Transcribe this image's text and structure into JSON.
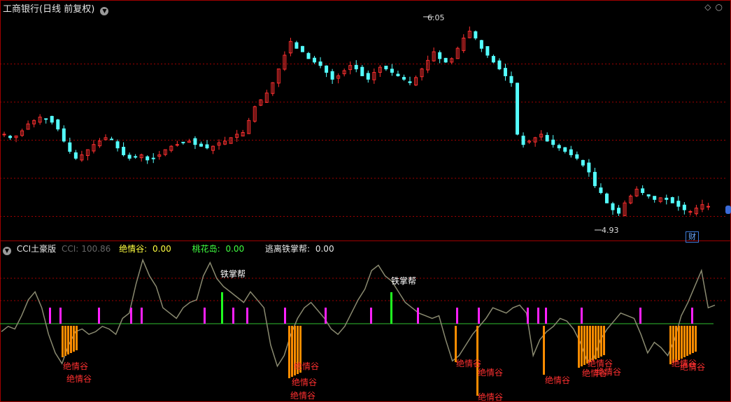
{
  "header": {
    "title": "工商银行(日线 前复权)",
    "right_icons": [
      "diamond-icon",
      "circle-icon"
    ]
  },
  "price_chart": {
    "high_label": "6.05",
    "low_label": "4.93",
    "badge": "财",
    "colors": {
      "up": "#ff3030",
      "down": "#54ffff",
      "grid": "#a00000"
    }
  },
  "indicator": {
    "name": "CCI土豪版",
    "cci_label": "CCI:",
    "cci_value": "100.86",
    "juequgu_label": "绝情谷:",
    "juequgu_value": "0.00",
    "taohuadao_label": "桃花岛:",
    "taohuadao_value": "0.00",
    "taoli_label": "逃离铁掌帮:",
    "taoli_value": "0.00",
    "signal_text_green": "铁掌帮",
    "signal_text_red": "绝情谷",
    "colors": {
      "cci": "#8a8a70",
      "zero": "#30c030",
      "magenta": "#ff20ff",
      "green": "#20ff20",
      "orange": "#ff8c00",
      "red_text": "#ff3030"
    }
  },
  "chart_data": [
    {
      "type": "candlestick",
      "title": "工商银行(日线 前复权)",
      "annotations": [
        {
          "label": "6.05",
          "kind": "high"
        },
        {
          "label": "4.93",
          "kind": "low"
        }
      ],
      "close": [
        5.42,
        5.4,
        5.41,
        5.44,
        5.48,
        5.5,
        5.52,
        5.51,
        5.49,
        5.45,
        5.38,
        5.32,
        5.28,
        5.3,
        5.33,
        5.36,
        5.38,
        5.4,
        5.39,
        5.34,
        5.3,
        5.28,
        5.29,
        5.3,
        5.27,
        5.28,
        5.3,
        5.33,
        5.35,
        5.36,
        5.37,
        5.38,
        5.36,
        5.35,
        5.34,
        5.35,
        5.37,
        5.38,
        5.4,
        5.42,
        5.43,
        5.5,
        5.58,
        5.62,
        5.66,
        5.72,
        5.8,
        5.88,
        5.96,
        5.92,
        5.9,
        5.86,
        5.84,
        5.82,
        5.78,
        5.74,
        5.76,
        5.79,
        5.82,
        5.8,
        5.76,
        5.74,
        5.78,
        5.81,
        5.8,
        5.78,
        5.76,
        5.74,
        5.72,
        5.75,
        5.8,
        5.85,
        5.9,
        5.86,
        5.84,
        5.86,
        5.92,
        5.98,
        6.02,
        5.98,
        5.92,
        5.88,
        5.84,
        5.8,
        5.76,
        5.72,
        5.42,
        5.36,
        5.38,
        5.4,
        5.42,
        5.38,
        5.36,
        5.34,
        5.32,
        5.3,
        5.28,
        5.24,
        5.2,
        5.12,
        5.08,
        5.02,
        4.98,
        4.96,
        5.02,
        5.06,
        5.1,
        5.08,
        5.06,
        5.04,
        5.05,
        5.04,
        5.02,
        5.0,
        4.98,
        4.97,
        4.99,
        5.01,
        5.0
      ]
    },
    {
      "type": "line",
      "title": "CCI土豪版",
      "series": [
        {
          "name": "CCI",
          "values": [
            -30,
            -10,
            -20,
            30,
            90,
            120,
            60,
            -40,
            -110,
            -150,
            -80,
            -30,
            -20,
            -40,
            -30,
            -10,
            -20,
            -40,
            20,
            40,
            150,
            240,
            180,
            140,
            60,
            40,
            20,
            60,
            80,
            90,
            180,
            230,
            170,
            140,
            120,
            100,
            80,
            120,
            90,
            60,
            -80,
            -160,
            -120,
            -40,
            20,
            60,
            80,
            50,
            20,
            -20,
            -40,
            -10,
            40,
            90,
            130,
            200,
            220,
            180,
            160,
            120,
            80,
            60,
            40,
            30,
            20,
            30,
            -60,
            -140,
            -120,
            -80,
            -40,
            -10,
            20,
            60,
            50,
            40,
            60,
            70,
            40,
            -120,
            -60,
            -30,
            -10,
            20,
            10,
            -20,
            -70,
            -140,
            -130,
            -60,
            -20,
            10,
            40,
            30,
            20,
            -40,
            -110,
            -70,
            -90,
            -120,
            -60,
            30,
            80,
            140,
            200,
            60,
            70
          ]
        }
      ]
    }
  ]
}
